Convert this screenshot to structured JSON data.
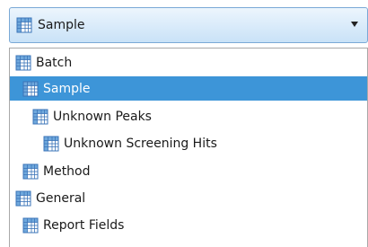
{
  "combo": {
    "selected_label": "Sample",
    "icon": "table-icon"
  },
  "dropdown": {
    "items": [
      {
        "label": "Batch",
        "icon": "table-icon",
        "level": 0,
        "selected": false
      },
      {
        "label": "Sample",
        "icon": "table-icon",
        "level": 1,
        "selected": true
      },
      {
        "label": "Unknown Peaks",
        "icon": "table-icon",
        "level": 2,
        "selected": false
      },
      {
        "label": "Unknown Screening Hits",
        "icon": "table-icon",
        "level": 3,
        "selected": false
      },
      {
        "label": "Method",
        "icon": "table-icon",
        "level": 1,
        "selected": false
      },
      {
        "label": "General",
        "icon": "table-icon",
        "level": 0,
        "selected": false
      },
      {
        "label": "Report Fields",
        "icon": "table-icon",
        "level": 1,
        "selected": false
      }
    ]
  },
  "colors": {
    "selection": "#3d95d8",
    "combo_border": "#7aa9d6"
  }
}
